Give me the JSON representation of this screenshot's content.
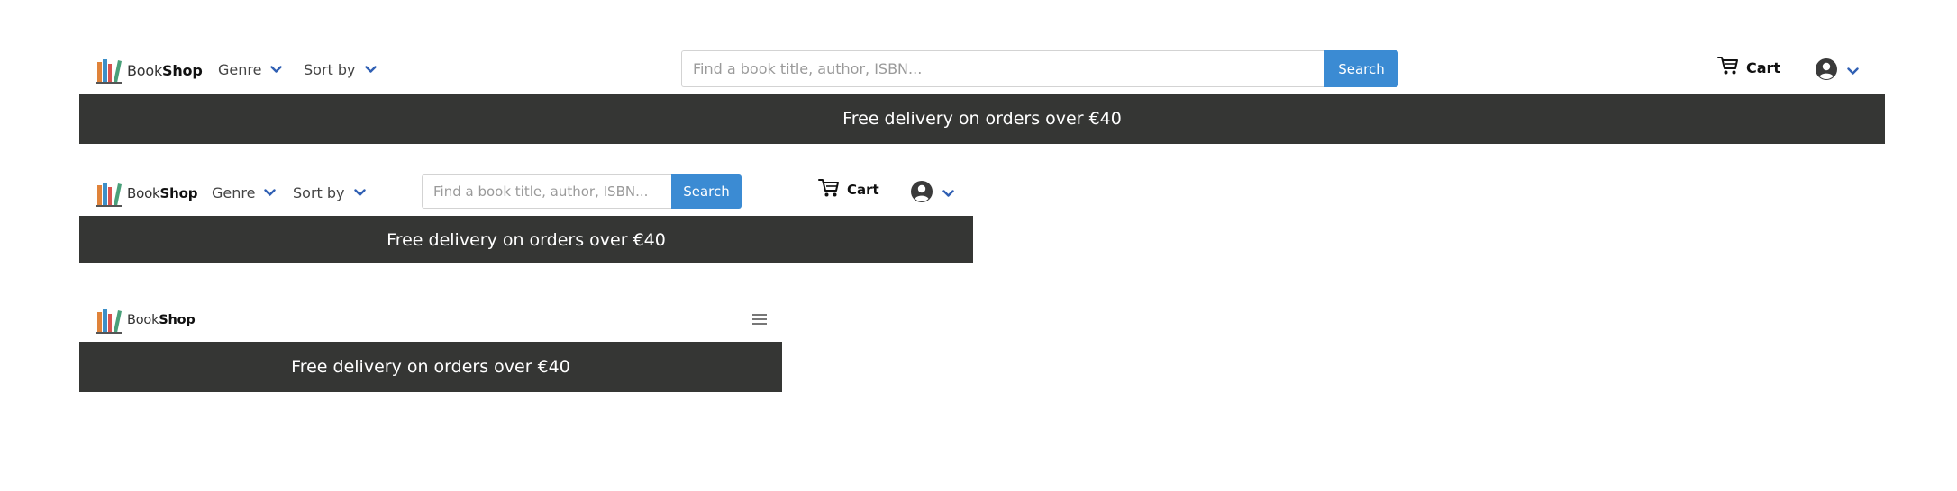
{
  "brand": {
    "name_regular": "Book",
    "name_bold": "Shop"
  },
  "nav": {
    "genre_label": "Genre",
    "sort_label": "Sort by",
    "cart_label": "Cart"
  },
  "search": {
    "placeholder": "Find a book title, author, ISBN...",
    "button_label": "Search"
  },
  "banner": {
    "text": "Free delivery on orders over €40"
  },
  "icons": {
    "logo": "books-logo-icon",
    "chevron": "chevron-down-icon",
    "cart": "cart-icon",
    "user": "user-circle-icon",
    "menu": "hamburger-menu-icon"
  },
  "colors": {
    "accent": "#3b8bd3",
    "banner_bg": "#353634",
    "banner_text": "#ffffff",
    "chevron": "#2f5fb3"
  }
}
